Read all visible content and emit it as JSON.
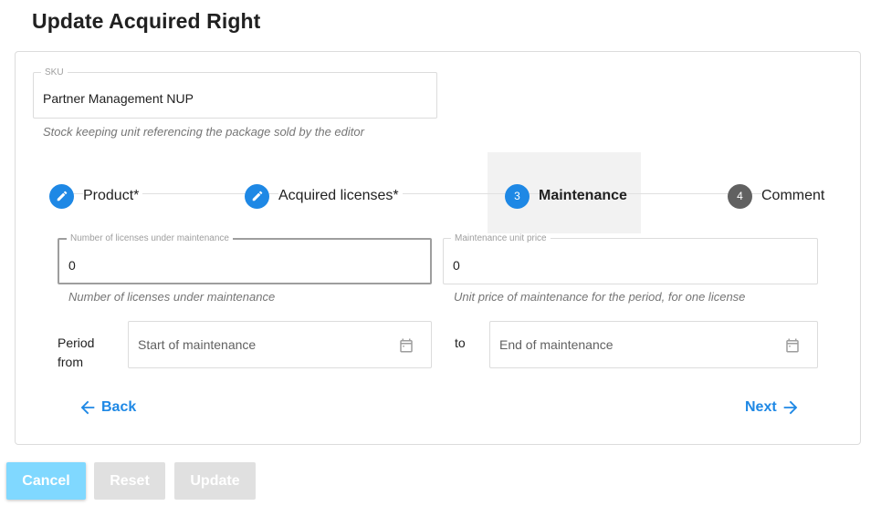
{
  "page": {
    "title": "Update Acquired Right"
  },
  "sku": {
    "label": "SKU",
    "value": "Partner Management NUP",
    "hint": "Stock keeping unit referencing the package sold by the editor"
  },
  "stepper": {
    "steps": [
      {
        "label": "Product*",
        "state": "done",
        "icon": "pencil-icon"
      },
      {
        "label": "Acquired licenses*",
        "state": "done",
        "icon": "pencil-icon"
      },
      {
        "label": "Maintenance",
        "state": "active",
        "number": "3"
      },
      {
        "label": "Comment",
        "state": "todo",
        "number": "4"
      }
    ]
  },
  "maintenance": {
    "licenses": {
      "label": "Number of licenses under maintenance",
      "value": "0",
      "hint": "Number of licenses under maintenance"
    },
    "unit_price": {
      "label": "Maintenance unit price",
      "value": "0",
      "hint": "Unit price of maintenance for the period, for one license"
    },
    "period": {
      "from_label": "Period from",
      "to_label": "to",
      "start_placeholder": "Start of maintenance",
      "end_placeholder": "End of maintenance"
    }
  },
  "nav": {
    "back_label": "Back",
    "next_label": "Next"
  },
  "actions": {
    "cancel_label": "Cancel",
    "reset_label": "Reset",
    "update_label": "Update"
  },
  "colors": {
    "primary": "#1e88e5",
    "cancel": "#80d8ff",
    "disabled": "#e0e0e0"
  }
}
